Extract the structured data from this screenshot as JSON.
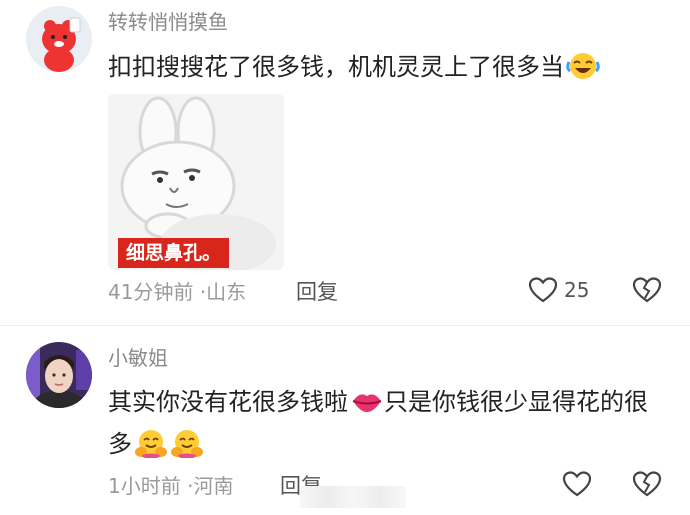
{
  "comments": [
    {
      "username": "转转悄悄摸鱼",
      "text": "扣扣搜搜花了很多钱，机机灵灵上了很多当",
      "emoji": "laughing-crying-emoji",
      "sticker": {
        "caption": "细思鼻孔。"
      },
      "time": "41分钟前",
      "location": "山东",
      "reply_label": "回复",
      "likes": "25"
    },
    {
      "username": "小敏姐",
      "text_part1": "其实你没有花很多钱啦",
      "emoji1": "kiss-lips-emoji",
      "text_part2": "只是你钱很少显得花的很多",
      "emoji2": "hugging-face-emoji",
      "time": "1小时前",
      "location": "河南",
      "reply_label": "回复"
    }
  ],
  "separator": "·",
  "colors": {
    "sticker_caption_bg": "#d9261c",
    "meta_gray": "#9a9a9a"
  }
}
